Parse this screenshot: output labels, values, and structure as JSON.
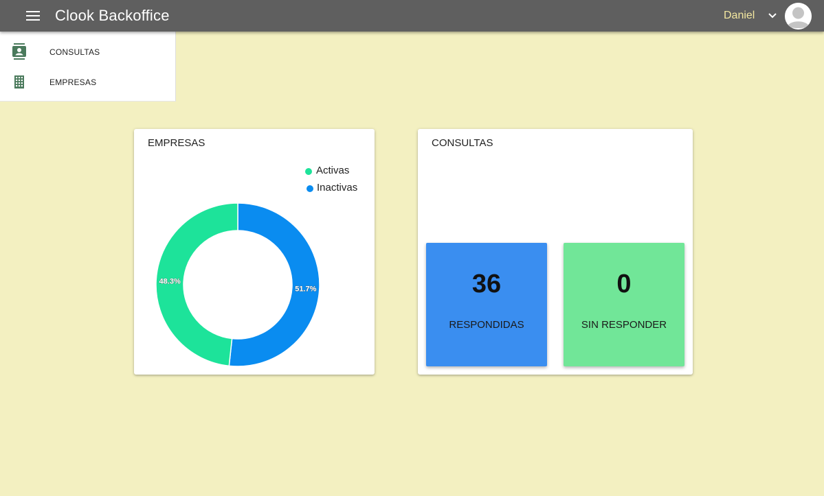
{
  "header": {
    "app_title": "Clook Backoffice",
    "menu_icon": "hamburger-menu-icon",
    "user_name": "Daniel",
    "user_menu_icon": "chevron-down-icon",
    "avatar_icon": "account-avatar-icon",
    "bar_color": "#5f5f5f",
    "user_name_color": "#f3e7a0"
  },
  "sidebar": {
    "items": [
      {
        "label": "CONSULTAS",
        "icon": "contacts-icon"
      },
      {
        "label": "EMPRESAS",
        "icon": "building-icon"
      }
    ],
    "icon_color": "#4a7a5c"
  },
  "page": {
    "background": "#f3f0c1"
  },
  "empresas_card": {
    "title": "EMPRESAS"
  },
  "consultas_card": {
    "title": "CONSULTAS",
    "tiles": [
      {
        "value": "36",
        "label": "RESPONDIDAS",
        "color": "#3a8ef0"
      },
      {
        "value": "0",
        "label": "SIN RESPONDER",
        "color": "#71e698"
      }
    ]
  },
  "chart_data": {
    "type": "pie",
    "variant": "donut",
    "categories": [
      "Activas",
      "Inactivas"
    ],
    "values": [
      48.3,
      51.7
    ],
    "value_labels": [
      "48.3%",
      "51.7%"
    ],
    "colors": [
      "#1de39a",
      "#0a8cf0"
    ],
    "legend": "top-right",
    "start": "top",
    "direction": "clockwise-from-top-inactivas-first"
  }
}
